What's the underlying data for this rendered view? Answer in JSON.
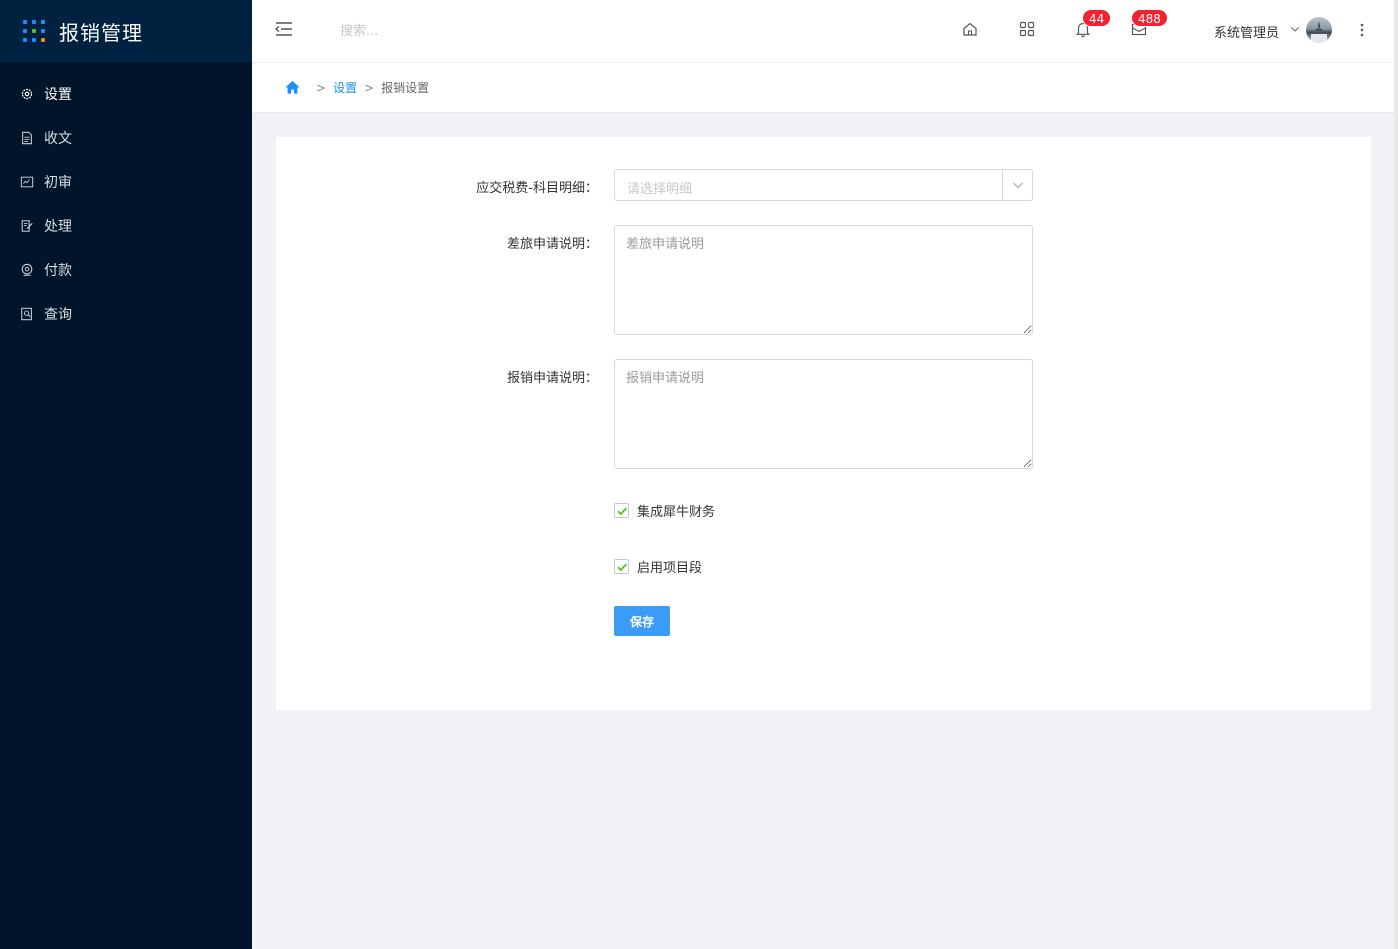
{
  "app": {
    "title": "报销管理",
    "logo_colors": [
      "#1890ff",
      "#1890ff",
      "#1890ff",
      "#1890ff",
      "#52c41a",
      "#1890ff",
      "#1890ff",
      "#1890ff",
      "#fa8c16"
    ]
  },
  "sidebar": {
    "items": [
      {
        "label": "设置",
        "icon": "gear-icon",
        "active": true
      },
      {
        "label": "收文",
        "icon": "document-icon",
        "active": false
      },
      {
        "label": "初审",
        "icon": "review-icon",
        "active": false
      },
      {
        "label": "处理",
        "icon": "edit-icon",
        "active": false
      },
      {
        "label": "付款",
        "icon": "payment-icon",
        "active": false
      },
      {
        "label": "查询",
        "icon": "query-icon",
        "active": false
      }
    ]
  },
  "header": {
    "search_placeholder": "搜索...",
    "notifications_count": "44",
    "messages_count": "488",
    "user_name": "系统管理员"
  },
  "breadcrumb": {
    "items": [
      "设置",
      "报销设置"
    ]
  },
  "form": {
    "tax_label": "应交税费-科目明细：",
    "tax_placeholder": "请选择明细",
    "travel_label": "差旅申请说明：",
    "travel_placeholder": "差旅申请说明",
    "reimburse_label": "报销申请说明：",
    "reimburse_placeholder": "报销申请说明",
    "checkbox_1": {
      "label": "集成犀牛财务",
      "checked": true
    },
    "checkbox_2": {
      "label": "启用项目段",
      "checked": true
    },
    "save_label": "保存"
  },
  "colors": {
    "sidebar_bg": "#001529",
    "accent": "#1890ff",
    "badge": "#f5222d",
    "checkmark": "#52c41a"
  }
}
